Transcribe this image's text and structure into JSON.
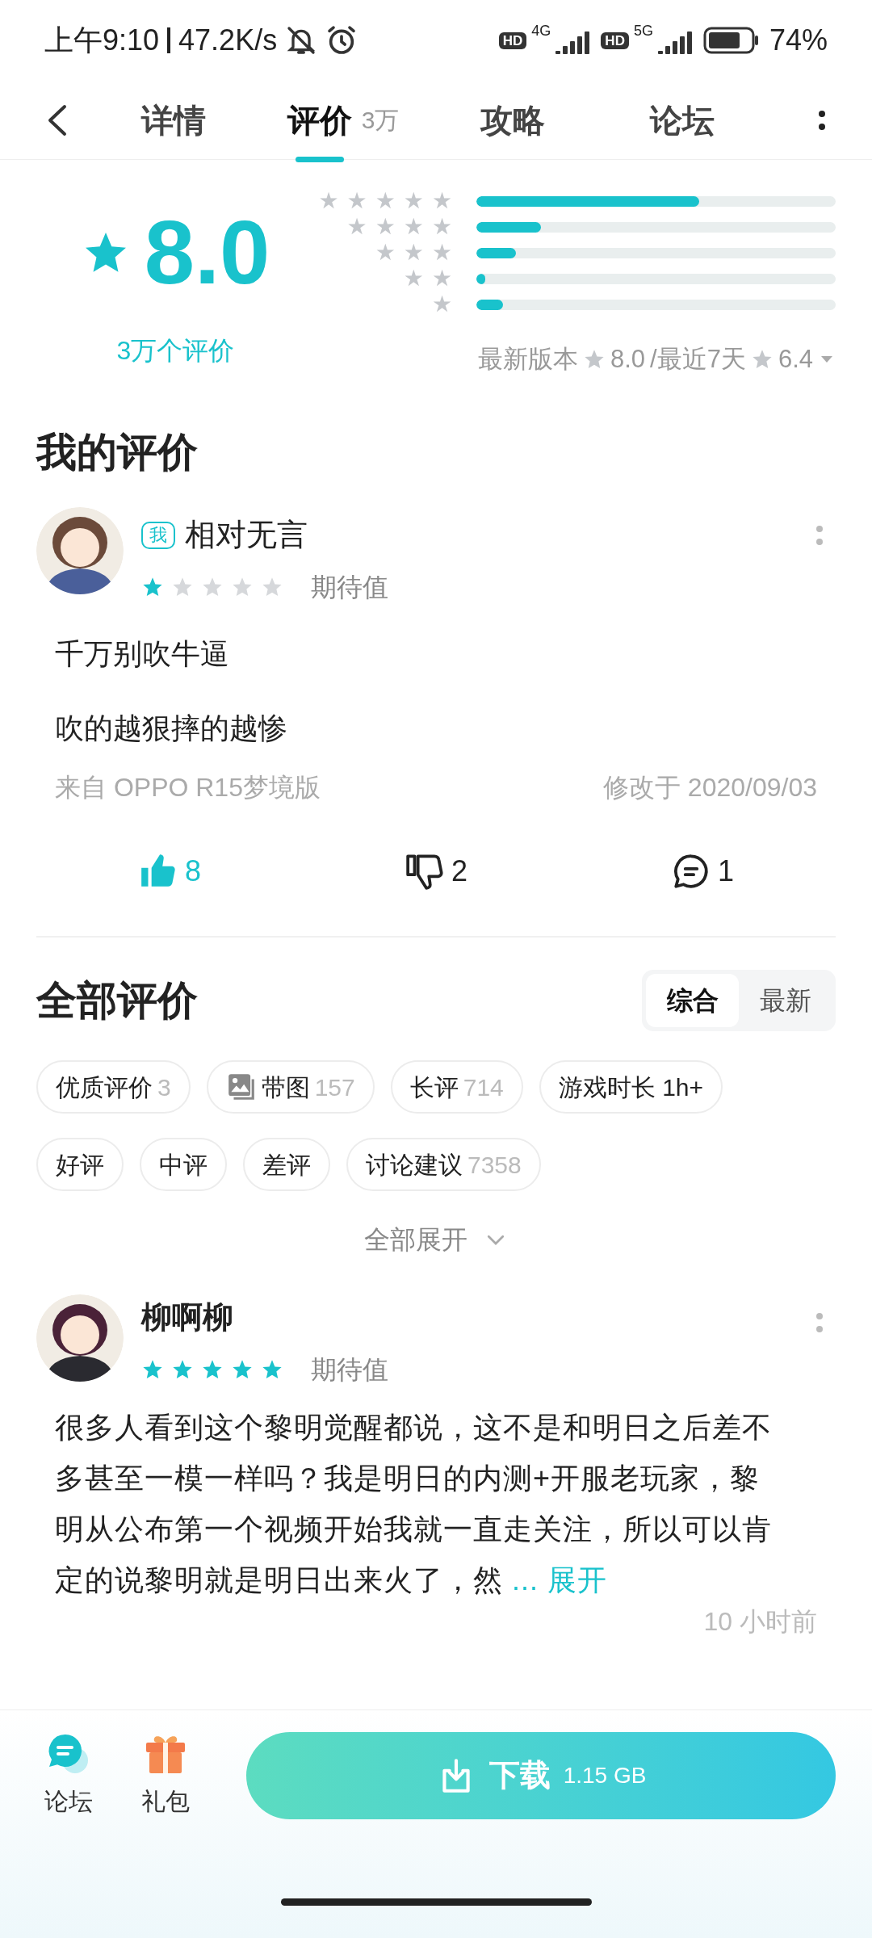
{
  "status_bar": {
    "time": "上午9:10",
    "network_speed": "47.2K/s",
    "signals": [
      {
        "badge": "HD",
        "network": "4G"
      },
      {
        "badge": "HD",
        "network": "5G"
      }
    ],
    "battery": "74%"
  },
  "tabs": [
    {
      "label": "详情",
      "selected": false
    },
    {
      "label": "评价",
      "count": "3万",
      "selected": true
    },
    {
      "label": "攻略",
      "selected": false
    },
    {
      "label": "论坛",
      "selected": false
    }
  ],
  "rating_summary": {
    "score": "8.0",
    "count_label": "3万个评价",
    "distribution": [
      {
        "label": "★★★★★",
        "level": 0.62
      },
      {
        "label": "★★★★",
        "level": 0.18
      },
      {
        "label": "★★★",
        "level": 0.11
      },
      {
        "label": "★★",
        "level": 0.025
      },
      {
        "label": "★",
        "level": 0.075
      }
    ],
    "latest_label": "最新版本",
    "latest_score": "8.0",
    "recent_label": "/最近7天",
    "recent_score": "6.4"
  },
  "my_review": {
    "heading": "我的评价",
    "badge": "我",
    "name": "相对无言",
    "stars": 1,
    "stars_label": "期待值",
    "paragraphs": [
      "千万别吹牛逼",
      "吹的越狠摔的越惨"
    ],
    "device": "来自 OPPO R15梦境版",
    "edited": "修改于 2020/09/03",
    "actions": [
      {
        "kind": "like",
        "count": "8",
        "selected": true
      },
      {
        "kind": "dislike",
        "count": "2",
        "selected": false
      },
      {
        "kind": "comment",
        "count": "1"
      }
    ]
  },
  "all_reviews": {
    "heading": "全部评价",
    "sort_options": [
      {
        "label": "综合",
        "selected": true
      },
      {
        "label": "最新",
        "selected": false
      }
    ],
    "filters": [
      {
        "label": "优质评价",
        "count": "3"
      },
      {
        "label": "带图",
        "count": "157",
        "kind": "image"
      },
      {
        "label": "长评",
        "count": "714"
      },
      {
        "label": "游戏时长 1h+"
      },
      {
        "label": "好评"
      },
      {
        "label": "中评"
      },
      {
        "label": "差评"
      },
      {
        "label": "讨论建议",
        "count": "7358"
      }
    ],
    "expand_label": "全部展开",
    "reviews": [
      {
        "name": "柳啊柳",
        "stars": 5,
        "stars_label": "期待值",
        "body": "很多人看到这个黎明觉醒都说，这不是和明日之后差不多甚至一模一样吗？我是明日的内测+开服老玩家，黎明从公布第一个视频开始我就一直走关注，所以可以肯定的说黎明就是明日出来火了，然",
        "ellipsis": "...",
        "more": "展开",
        "time": "10 小时前"
      }
    ]
  },
  "bottom_bar": {
    "items": [
      {
        "kind": "forum",
        "label": "论坛"
      },
      {
        "kind": "gift",
        "label": "礼包"
      }
    ],
    "download": {
      "label": "下载",
      "size": "1.15 GB"
    }
  }
}
